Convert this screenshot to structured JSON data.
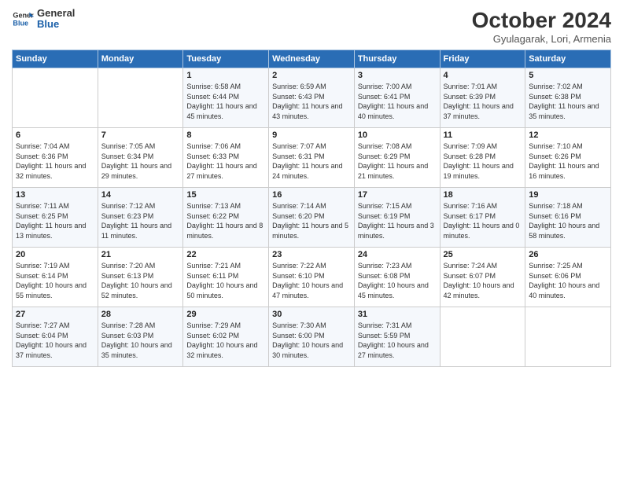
{
  "logo": {
    "line1": "General",
    "line2": "Blue"
  },
  "title": "October 2024",
  "subtitle": "Gyulagarak, Lori, Armenia",
  "headers": [
    "Sunday",
    "Monday",
    "Tuesday",
    "Wednesday",
    "Thursday",
    "Friday",
    "Saturday"
  ],
  "weeks": [
    [
      {
        "day": "",
        "sunrise": "",
        "sunset": "",
        "daylight": ""
      },
      {
        "day": "",
        "sunrise": "",
        "sunset": "",
        "daylight": ""
      },
      {
        "day": "1",
        "sunrise": "Sunrise: 6:58 AM",
        "sunset": "Sunset: 6:44 PM",
        "daylight": "Daylight: 11 hours and 45 minutes."
      },
      {
        "day": "2",
        "sunrise": "Sunrise: 6:59 AM",
        "sunset": "Sunset: 6:43 PM",
        "daylight": "Daylight: 11 hours and 43 minutes."
      },
      {
        "day": "3",
        "sunrise": "Sunrise: 7:00 AM",
        "sunset": "Sunset: 6:41 PM",
        "daylight": "Daylight: 11 hours and 40 minutes."
      },
      {
        "day": "4",
        "sunrise": "Sunrise: 7:01 AM",
        "sunset": "Sunset: 6:39 PM",
        "daylight": "Daylight: 11 hours and 37 minutes."
      },
      {
        "day": "5",
        "sunrise": "Sunrise: 7:02 AM",
        "sunset": "Sunset: 6:38 PM",
        "daylight": "Daylight: 11 hours and 35 minutes."
      }
    ],
    [
      {
        "day": "6",
        "sunrise": "Sunrise: 7:04 AM",
        "sunset": "Sunset: 6:36 PM",
        "daylight": "Daylight: 11 hours and 32 minutes."
      },
      {
        "day": "7",
        "sunrise": "Sunrise: 7:05 AM",
        "sunset": "Sunset: 6:34 PM",
        "daylight": "Daylight: 11 hours and 29 minutes."
      },
      {
        "day": "8",
        "sunrise": "Sunrise: 7:06 AM",
        "sunset": "Sunset: 6:33 PM",
        "daylight": "Daylight: 11 hours and 27 minutes."
      },
      {
        "day": "9",
        "sunrise": "Sunrise: 7:07 AM",
        "sunset": "Sunset: 6:31 PM",
        "daylight": "Daylight: 11 hours and 24 minutes."
      },
      {
        "day": "10",
        "sunrise": "Sunrise: 7:08 AM",
        "sunset": "Sunset: 6:29 PM",
        "daylight": "Daylight: 11 hours and 21 minutes."
      },
      {
        "day": "11",
        "sunrise": "Sunrise: 7:09 AM",
        "sunset": "Sunset: 6:28 PM",
        "daylight": "Daylight: 11 hours and 19 minutes."
      },
      {
        "day": "12",
        "sunrise": "Sunrise: 7:10 AM",
        "sunset": "Sunset: 6:26 PM",
        "daylight": "Daylight: 11 hours and 16 minutes."
      }
    ],
    [
      {
        "day": "13",
        "sunrise": "Sunrise: 7:11 AM",
        "sunset": "Sunset: 6:25 PM",
        "daylight": "Daylight: 11 hours and 13 minutes."
      },
      {
        "day": "14",
        "sunrise": "Sunrise: 7:12 AM",
        "sunset": "Sunset: 6:23 PM",
        "daylight": "Daylight: 11 hours and 11 minutes."
      },
      {
        "day": "15",
        "sunrise": "Sunrise: 7:13 AM",
        "sunset": "Sunset: 6:22 PM",
        "daylight": "Daylight: 11 hours and 8 minutes."
      },
      {
        "day": "16",
        "sunrise": "Sunrise: 7:14 AM",
        "sunset": "Sunset: 6:20 PM",
        "daylight": "Daylight: 11 hours and 5 minutes."
      },
      {
        "day": "17",
        "sunrise": "Sunrise: 7:15 AM",
        "sunset": "Sunset: 6:19 PM",
        "daylight": "Daylight: 11 hours and 3 minutes."
      },
      {
        "day": "18",
        "sunrise": "Sunrise: 7:16 AM",
        "sunset": "Sunset: 6:17 PM",
        "daylight": "Daylight: 11 hours and 0 minutes."
      },
      {
        "day": "19",
        "sunrise": "Sunrise: 7:18 AM",
        "sunset": "Sunset: 6:16 PM",
        "daylight": "Daylight: 10 hours and 58 minutes."
      }
    ],
    [
      {
        "day": "20",
        "sunrise": "Sunrise: 7:19 AM",
        "sunset": "Sunset: 6:14 PM",
        "daylight": "Daylight: 10 hours and 55 minutes."
      },
      {
        "day": "21",
        "sunrise": "Sunrise: 7:20 AM",
        "sunset": "Sunset: 6:13 PM",
        "daylight": "Daylight: 10 hours and 52 minutes."
      },
      {
        "day": "22",
        "sunrise": "Sunrise: 7:21 AM",
        "sunset": "Sunset: 6:11 PM",
        "daylight": "Daylight: 10 hours and 50 minutes."
      },
      {
        "day": "23",
        "sunrise": "Sunrise: 7:22 AM",
        "sunset": "Sunset: 6:10 PM",
        "daylight": "Daylight: 10 hours and 47 minutes."
      },
      {
        "day": "24",
        "sunrise": "Sunrise: 7:23 AM",
        "sunset": "Sunset: 6:08 PM",
        "daylight": "Daylight: 10 hours and 45 minutes."
      },
      {
        "day": "25",
        "sunrise": "Sunrise: 7:24 AM",
        "sunset": "Sunset: 6:07 PM",
        "daylight": "Daylight: 10 hours and 42 minutes."
      },
      {
        "day": "26",
        "sunrise": "Sunrise: 7:25 AM",
        "sunset": "Sunset: 6:06 PM",
        "daylight": "Daylight: 10 hours and 40 minutes."
      }
    ],
    [
      {
        "day": "27",
        "sunrise": "Sunrise: 7:27 AM",
        "sunset": "Sunset: 6:04 PM",
        "daylight": "Daylight: 10 hours and 37 minutes."
      },
      {
        "day": "28",
        "sunrise": "Sunrise: 7:28 AM",
        "sunset": "Sunset: 6:03 PM",
        "daylight": "Daylight: 10 hours and 35 minutes."
      },
      {
        "day": "29",
        "sunrise": "Sunrise: 7:29 AM",
        "sunset": "Sunset: 6:02 PM",
        "daylight": "Daylight: 10 hours and 32 minutes."
      },
      {
        "day": "30",
        "sunrise": "Sunrise: 7:30 AM",
        "sunset": "Sunset: 6:00 PM",
        "daylight": "Daylight: 10 hours and 30 minutes."
      },
      {
        "day": "31",
        "sunrise": "Sunrise: 7:31 AM",
        "sunset": "Sunset: 5:59 PM",
        "daylight": "Daylight: 10 hours and 27 minutes."
      },
      {
        "day": "",
        "sunrise": "",
        "sunset": "",
        "daylight": ""
      },
      {
        "day": "",
        "sunrise": "",
        "sunset": "",
        "daylight": ""
      }
    ]
  ]
}
